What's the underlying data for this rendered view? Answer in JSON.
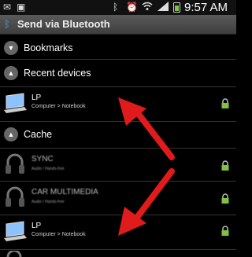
{
  "status_bar": {
    "time": "9:57 AM",
    "left_icons": [
      "mail-icon",
      "image-icon"
    ],
    "right_icons": [
      "bluetooth-icon",
      "alarm-icon",
      "wifi-icon",
      "signal-icon",
      "battery-icon"
    ]
  },
  "title_bar": {
    "title": "Send via Bluetooth",
    "icon": "bluetooth-icon"
  },
  "sections": {
    "bookmarks": "Bookmarks",
    "recent": "Recent devices",
    "cache": "Cache"
  },
  "recent_devices": [
    {
      "name": "LP",
      "type": "Computer > Notebook",
      "icon": "laptop-icon"
    }
  ],
  "cache_devices": [
    {
      "name": "SYNC",
      "type": "Audio / Hands-free",
      "icon": "headset-icon"
    },
    {
      "name": "CAR MULTIMEDIA",
      "type": "Audio / Hands-free",
      "icon": "headset-icon"
    },
    {
      "name": "LP",
      "type": "Computer > Notebook",
      "icon": "laptop-icon"
    }
  ],
  "colors": {
    "title_bar": "#4c4c4c",
    "bluetooth_blue": "#3aa0e6",
    "arrow_red": "#e01b1b",
    "lock_green": "#7ec242"
  }
}
